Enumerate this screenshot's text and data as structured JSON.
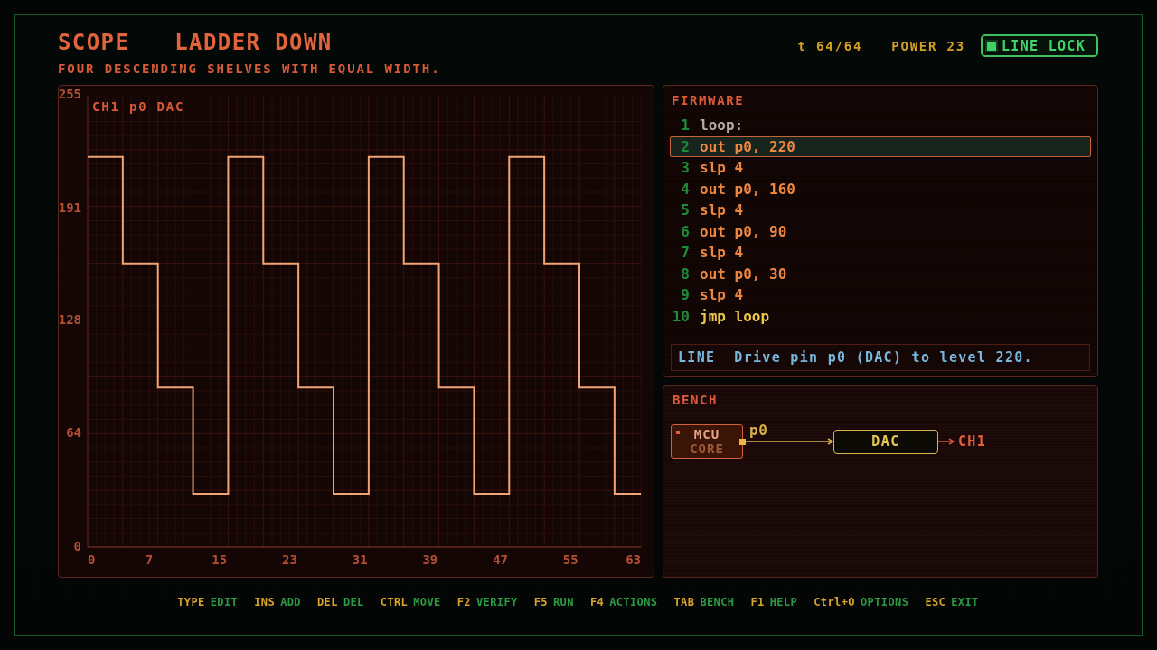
{
  "header": {
    "mode": "SCOPE",
    "title": "LADDER DOWN",
    "subtitle": "FOUR DESCENDING SHELVES WITH EQUAL WIDTH.",
    "time": "t 64/64",
    "power": "POWER 23",
    "lock_button": {
      "label": "LINE LOCK",
      "on": true
    }
  },
  "scope": {
    "chart_data": {
      "type": "line",
      "title": "CH1 p0 DAC",
      "x": [
        0,
        4,
        4,
        8,
        8,
        12,
        12,
        16,
        16,
        20,
        20,
        24,
        24,
        28,
        28,
        32,
        32,
        36,
        36,
        40,
        40,
        44,
        44,
        48,
        48,
        52,
        52,
        56,
        56,
        60,
        60,
        63
      ],
      "values": [
        220,
        220,
        160,
        160,
        90,
        90,
        30,
        30,
        220,
        220,
        160,
        160,
        90,
        90,
        30,
        30,
        220,
        220,
        160,
        160,
        90,
        90,
        30,
        30,
        220,
        220,
        160,
        160,
        90,
        90,
        30,
        30
      ],
      "xlim": [
        0,
        63
      ],
      "ylim": [
        0,
        255
      ],
      "xticks": [
        0,
        7,
        15,
        23,
        31,
        39,
        47,
        55,
        63
      ],
      "yticks": [
        0,
        64,
        128,
        191,
        255
      ],
      "grid": true
    }
  },
  "firmware": {
    "title": "FIRMWARE",
    "lines": [
      {
        "number": "1",
        "code": "loop:",
        "kind": "label",
        "selected": false
      },
      {
        "number": "2",
        "code": "out p0, 220",
        "kind": "op",
        "selected": true
      },
      {
        "number": "3",
        "code": "slp 4",
        "kind": "op",
        "selected": false
      },
      {
        "number": "4",
        "code": "out p0, 160",
        "kind": "op",
        "selected": false
      },
      {
        "number": "5",
        "code": "slp 4",
        "kind": "op",
        "selected": false
      },
      {
        "number": "6",
        "code": "out p0, 90",
        "kind": "op",
        "selected": false
      },
      {
        "number": "7",
        "code": "slp 4",
        "kind": "op",
        "selected": false
      },
      {
        "number": "8",
        "code": "out p0, 30",
        "kind": "op",
        "selected": false
      },
      {
        "number": "9",
        "code": "slp 4",
        "kind": "op",
        "selected": false
      },
      {
        "number": "10",
        "code": "jmp loop",
        "kind": "jump",
        "selected": false
      }
    ],
    "info": {
      "label": "LINE",
      "text": "Drive pin p0 (DAC) to level 220."
    }
  },
  "bench": {
    "title": "BENCH",
    "source": {
      "label": "MCU",
      "sublabel": "CORE"
    },
    "pin": "p0",
    "target": "DAC",
    "output": "CH1"
  },
  "hotkeys": [
    {
      "key": "TYPE",
      "action": "EDIT"
    },
    {
      "key": "INS",
      "action": "ADD"
    },
    {
      "key": "DEL",
      "action": "DEL"
    },
    {
      "key": "CTRL",
      "action": "MOVE"
    },
    {
      "key": "F2",
      "action": "VERIFY"
    },
    {
      "key": "F5",
      "action": "RUN"
    },
    {
      "key": "F4",
      "action": "ACTIONS"
    },
    {
      "key": "TAB",
      "action": "BENCH"
    },
    {
      "key": "F1",
      "action": "HELP"
    },
    {
      "key": "Ctrl+O",
      "action": "OPTIONS"
    },
    {
      "key": "ESC",
      "action": "EXIT"
    }
  ]
}
